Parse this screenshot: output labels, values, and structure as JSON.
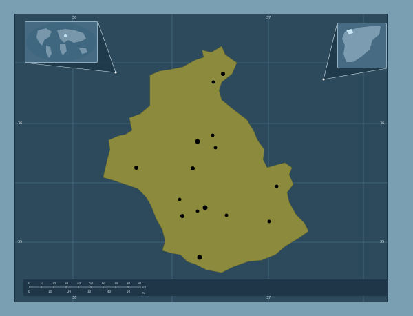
{
  "colors": {
    "background": "#7a9fb3",
    "frame": "#2c4a5c",
    "region_fill": "#8c8b3d",
    "region_stroke": "#6f6e2f",
    "graticule": "#5f8aa0",
    "point": "#111111"
  },
  "map": {
    "region_name": "",
    "settlements": []
  },
  "graticule": {
    "top_labels": [
      "36",
      "37"
    ],
    "bottom_labels": [
      "36",
      "37"
    ],
    "left_labels": [
      "36",
      "35"
    ],
    "right_labels": [
      "36",
      "35"
    ]
  },
  "scalebar": {
    "km_ticks": [
      "0",
      "10",
      "20",
      "30",
      "40",
      "50",
      "60",
      "70",
      "80",
      "90"
    ],
    "mi_ticks": [
      "0",
      "10",
      "20",
      "30",
      "40",
      "50"
    ],
    "km_label": "km",
    "mi_label": "mi"
  },
  "insets": {
    "world": "world-locator-map",
    "country": "country-locator-map"
  }
}
